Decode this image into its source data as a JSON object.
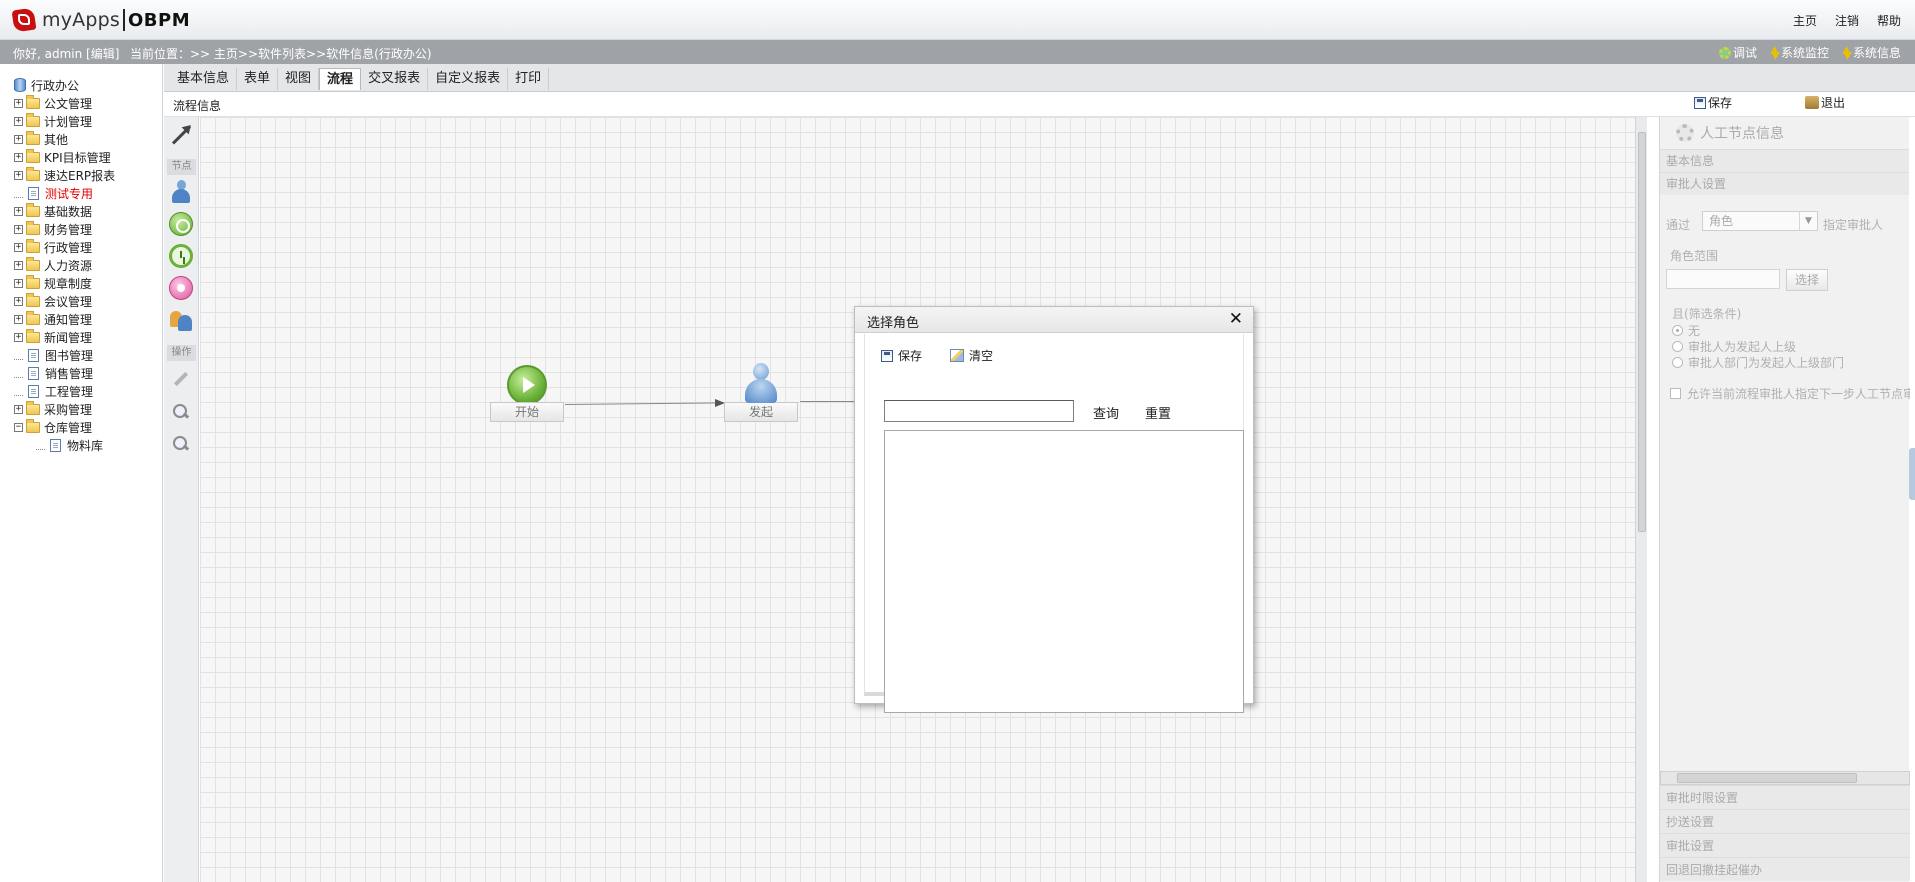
{
  "header": {
    "logo_text": "myApps",
    "logo_suffix": "OBPM",
    "links": [
      "主页",
      "注销",
      "帮助"
    ]
  },
  "status": {
    "greeting": "你好, admin [编辑]",
    "breadcrumb": "当前位置：>> 主页>>软件列表>>软件信息(行政办公)",
    "links": [
      "调试",
      "系统监控",
      "系统信息"
    ]
  },
  "sidebar": {
    "root": "行政办公",
    "items": [
      {
        "label": "公文管理",
        "type": "folder"
      },
      {
        "label": "计划管理",
        "type": "folder"
      },
      {
        "label": "其他",
        "type": "folder"
      },
      {
        "label": "KPI目标管理",
        "type": "folder"
      },
      {
        "label": "速达ERP报表",
        "type": "folder"
      },
      {
        "label": "测试专用",
        "type": "page",
        "highlight": true
      },
      {
        "label": "基础数据",
        "type": "folder"
      },
      {
        "label": "财务管理",
        "type": "folder"
      },
      {
        "label": "行政管理",
        "type": "folder"
      },
      {
        "label": "人力资源",
        "type": "folder"
      },
      {
        "label": "规章制度",
        "type": "folder"
      },
      {
        "label": "会议管理",
        "type": "folder"
      },
      {
        "label": "通知管理",
        "type": "folder"
      },
      {
        "label": "新闻管理",
        "type": "folder"
      },
      {
        "label": "图书管理",
        "type": "page"
      },
      {
        "label": "销售管理",
        "type": "page"
      },
      {
        "label": "工程管理",
        "type": "page"
      },
      {
        "label": "采购管理",
        "type": "folder"
      },
      {
        "label": "仓库管理",
        "type": "folder",
        "expanded": true
      },
      {
        "label": "物料库",
        "type": "page",
        "child": true
      }
    ]
  },
  "tabs": [
    "基本信息",
    "表单",
    "视图",
    "流程",
    "交叉报表",
    "自定义报表",
    "打印"
  ],
  "active_tab": "流程",
  "subheader": {
    "title": "流程信息",
    "save": "保存",
    "exit": "退出"
  },
  "palette": {
    "section_nodes": "节点",
    "section_ops": "操作"
  },
  "flow": {
    "start_label": "开始",
    "launch_label": "发起"
  },
  "right_panel": {
    "title": "人工节点信息",
    "sec_basic": "基本信息",
    "sec_approver": "审批人设置",
    "via_label": "通过",
    "via_value": "角色",
    "assign_label": "指定审批人",
    "role_scope_label": "角色范围",
    "choose_button": "选择",
    "filter_label": "且(筛选条件)",
    "radio_options": [
      "无",
      "审批人为发起人上级",
      "审批人部门为发起人上级部门"
    ],
    "checkbox_label": "允许当前流程审批人指定下一步人工节点审批人",
    "bottom_sections": [
      "审批时限设置",
      "抄送设置",
      "审批设置",
      "回退回撤挂起催办"
    ]
  },
  "dialog": {
    "title": "选择角色",
    "close": "✕",
    "save": "保存",
    "clear": "清空",
    "search_value": "",
    "query": "查询",
    "reset": "重置"
  }
}
